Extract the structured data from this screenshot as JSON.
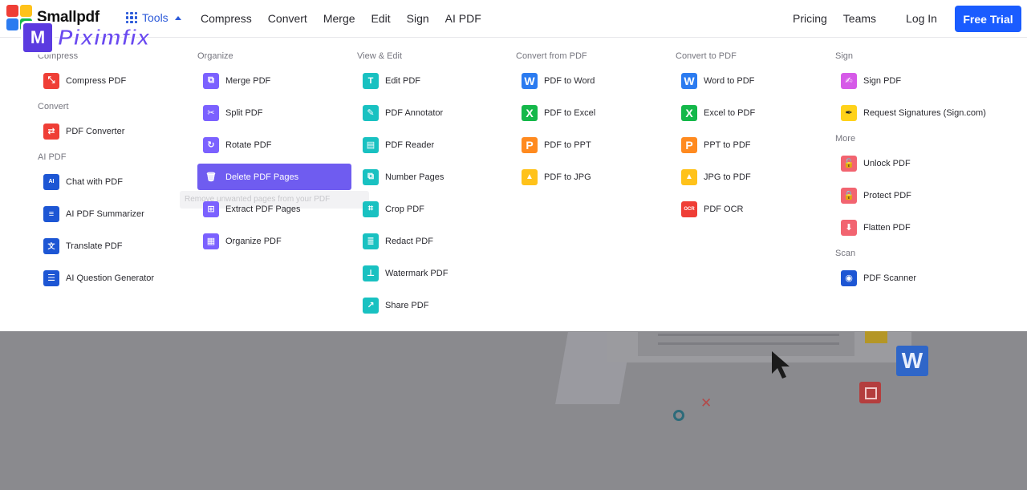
{
  "brand": {
    "name": "Smallpdf",
    "watermark": "Piximfix"
  },
  "header": {
    "tools_label": "Tools",
    "nav": [
      "Compress",
      "Convert",
      "Merge",
      "Edit",
      "Sign",
      "AI PDF"
    ],
    "pricing": "Pricing",
    "teams": "Teams",
    "login": "Log In",
    "free_trial": "Free Trial"
  },
  "menu": {
    "col1": {
      "compress": {
        "label": "Compress",
        "items": [
          {
            "label": "Compress PDF",
            "icon": "compress-icon",
            "color": "#ef3e36"
          }
        ]
      },
      "convert": {
        "label": "Convert",
        "items": [
          {
            "label": "PDF Converter",
            "icon": "converter-icon",
            "color": "#ef3e36"
          }
        ]
      },
      "ai": {
        "label": "AI PDF",
        "items": [
          {
            "label": "Chat with PDF",
            "icon": "chat-icon",
            "color": "#1d56d4"
          },
          {
            "label": "AI PDF Summarizer",
            "icon": "summarizer-icon",
            "color": "#1d56d4"
          },
          {
            "label": "Translate PDF",
            "icon": "translate-icon",
            "color": "#1d56d4"
          },
          {
            "label": "AI Question Generator",
            "icon": "question-icon",
            "color": "#1d56d4"
          }
        ]
      }
    },
    "col2": {
      "label": "Organize",
      "tooltip": "Remove unwanted pages from your PDF",
      "items": [
        {
          "label": "Merge PDF",
          "icon": "merge-icon",
          "color": "#7b61ff"
        },
        {
          "label": "Split PDF",
          "icon": "split-icon",
          "color": "#7b61ff"
        },
        {
          "label": "Rotate PDF",
          "icon": "rotate-icon",
          "color": "#7b61ff"
        },
        {
          "label": "Delete PDF Pages",
          "icon": "trash-icon",
          "color": "#6f5cf0"
        },
        {
          "label": "Extract PDF Pages",
          "icon": "extract-icon",
          "color": "#7b61ff"
        },
        {
          "label": "Organize PDF",
          "icon": "organize-icon",
          "color": "#7b61ff"
        }
      ]
    },
    "col3": {
      "label": "View & Edit",
      "items": [
        {
          "label": "Edit PDF",
          "icon": "edit-icon",
          "color": "#19c1c1"
        },
        {
          "label": "PDF Annotator",
          "icon": "annotator-icon",
          "color": "#19c1c1"
        },
        {
          "label": "PDF Reader",
          "icon": "reader-icon",
          "color": "#19c1c1"
        },
        {
          "label": "Number Pages",
          "icon": "number-icon",
          "color": "#19c1c1"
        },
        {
          "label": "Crop PDF",
          "icon": "crop-icon",
          "color": "#19c1c1"
        },
        {
          "label": "Redact PDF",
          "icon": "redact-icon",
          "color": "#19c1c1"
        },
        {
          "label": "Watermark PDF",
          "icon": "watermark-icon",
          "color": "#19c1c1"
        },
        {
          "label": "Share PDF",
          "icon": "share-icon",
          "color": "#19c1c1"
        }
      ]
    },
    "col4": {
      "label": "Convert from PDF",
      "items": [
        {
          "label": "PDF to Word",
          "icon": "word-icon",
          "color": "#2b7bf0",
          "glyph": "W"
        },
        {
          "label": "PDF to Excel",
          "icon": "excel-icon",
          "color": "#14b84a",
          "glyph": "X"
        },
        {
          "label": "PDF to PPT",
          "icon": "ppt-icon",
          "color": "#ff8a1f",
          "glyph": "P"
        },
        {
          "label": "PDF to JPG",
          "icon": "jpg-icon",
          "color": "#ffc21a",
          "glyph": "▲"
        }
      ]
    },
    "col5": {
      "label": "Convert to PDF",
      "items": [
        {
          "label": "Word to PDF",
          "icon": "word-icon",
          "color": "#2b7bf0",
          "glyph": "W"
        },
        {
          "label": "Excel to PDF",
          "icon": "excel-icon",
          "color": "#14b84a",
          "glyph": "X"
        },
        {
          "label": "PPT to PDF",
          "icon": "ppt-icon",
          "color": "#ff8a1f",
          "glyph": "P"
        },
        {
          "label": "JPG to PDF",
          "icon": "jpg-icon",
          "color": "#ffc21a",
          "glyph": "▲"
        },
        {
          "label": "PDF OCR",
          "icon": "ocr-icon",
          "color": "#ef3e36",
          "glyph": "OCR"
        }
      ]
    },
    "col6": {
      "sign": {
        "label": "Sign",
        "items": [
          {
            "label": "Sign PDF",
            "icon": "sign-icon",
            "color": "#d65ae8"
          },
          {
            "label": "Request Signatures (Sign.com)",
            "icon": "pen-icon",
            "color": "#ffd21a"
          }
        ]
      },
      "more": {
        "label": "More",
        "items": [
          {
            "label": "Unlock PDF",
            "icon": "unlock-icon",
            "color": "#f26470"
          },
          {
            "label": "Protect PDF",
            "icon": "lock-icon",
            "color": "#f26470"
          },
          {
            "label": "Flatten PDF",
            "icon": "flatten-icon",
            "color": "#f26470"
          }
        ]
      },
      "scan": {
        "label": "Scan",
        "items": [
          {
            "label": "PDF Scanner",
            "icon": "camera-icon",
            "color": "#1d56d4"
          }
        ]
      }
    }
  },
  "colors": {
    "accent": "#1a5cff",
    "active_item": "#6f5cf0",
    "overlay": "#8a8a8e"
  }
}
